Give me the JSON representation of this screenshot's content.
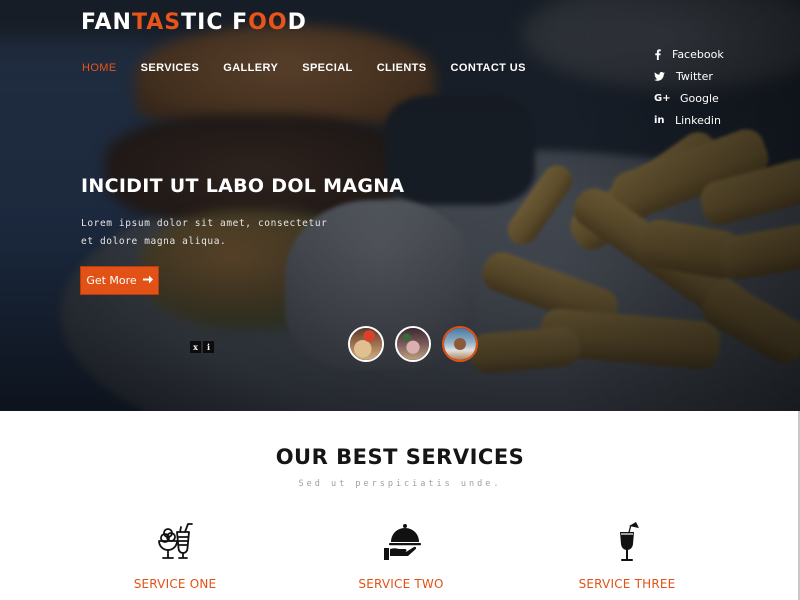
{
  "brand": {
    "logo_parts": [
      {
        "text": "FAN",
        "accent": false
      },
      {
        "text": "TAS",
        "accent": true
      },
      {
        "text": "TIC F",
        "accent": false
      },
      {
        "text": "OO",
        "accent": true
      },
      {
        "text": "D",
        "accent": false
      }
    ],
    "accent_color": "#e25115"
  },
  "nav": {
    "items": [
      {
        "label": "HOME",
        "active": true
      },
      {
        "label": "SERVICES",
        "active": false
      },
      {
        "label": "GALLERY",
        "active": false
      },
      {
        "label": "SPECIAL",
        "active": false
      },
      {
        "label": "CLIENTS",
        "active": false
      },
      {
        "label": "CONTACT US",
        "active": false
      }
    ]
  },
  "social": {
    "items": [
      {
        "icon": "facebook-icon",
        "glyph": "f",
        "label": "Facebook"
      },
      {
        "icon": "twitter-icon",
        "glyph": "🐦",
        "label": "Twitter"
      },
      {
        "icon": "google-plus-icon",
        "glyph": "G+",
        "label": "Google"
      },
      {
        "icon": "linkedin-icon",
        "glyph": "in",
        "label": "Linkedin"
      }
    ]
  },
  "hero": {
    "title": "INCIDIT UT LABO DOL MAGNA",
    "description": "Lorem ipsum dolor sit amet, consectetur et dolore magna aliqua.",
    "button_label": "Get More",
    "button_icon": "arrow-right-icon",
    "slider_prev": "x",
    "slider_next": "i",
    "thumbnails": [
      {
        "name": "thumbnail-1",
        "active": false
      },
      {
        "name": "thumbnail-2",
        "active": false
      },
      {
        "name": "thumbnail-3",
        "active": true
      }
    ]
  },
  "services": {
    "title": "OUR BEST SERVICES",
    "subtitle": "Sed ut perspiciatis unde.",
    "items": [
      {
        "label": "SERVICE ONE",
        "icon": "dessert-drink-icon"
      },
      {
        "label": "SERVICE TWO",
        "icon": "serving-cloche-icon"
      },
      {
        "label": "SERVICE THREE",
        "icon": "cocktail-icon"
      }
    ]
  }
}
